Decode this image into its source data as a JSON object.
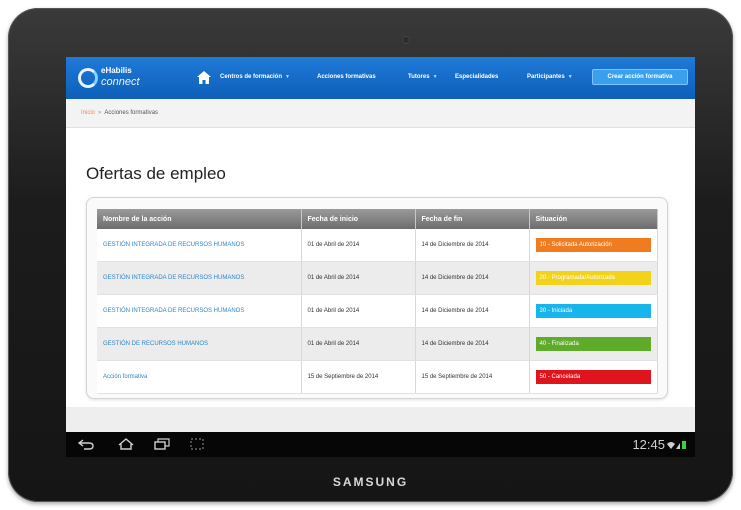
{
  "device": {
    "brand": "SAMSUNG"
  },
  "logo": {
    "line1": "eHabilis",
    "line2": "connect"
  },
  "nav": {
    "items": [
      {
        "label": "Centros de formación",
        "caret": "▼"
      },
      {
        "label": "Acciones formativas",
        "caret": ""
      },
      {
        "label": "Tutores",
        "caret": "▼"
      },
      {
        "label": "Especialidades",
        "caret": ""
      },
      {
        "label": "Participantes",
        "caret": "▼"
      }
    ],
    "create_button": "Crear acción formativa"
  },
  "breadcrumb": {
    "home": "Inicio",
    "separator": "»",
    "current": "Acciones formativas"
  },
  "page_title": "Ofertas de empleo",
  "table": {
    "headers": [
      "Nombre de la acción",
      "Fecha de inicio",
      "Fecha de fin",
      "Situación"
    ],
    "rows": [
      {
        "name": "GESTIÓN INTEGRADA DE RECURSOS HUMANOS",
        "start": "01 de Abril de 2014",
        "end": "14 de Diciembre de 2014",
        "status": "10 - Solicitada Autorización",
        "status_color": "#f07c1f"
      },
      {
        "name": "GESTIÓN INTEGRADA DE RECURSOS HUMANOS",
        "start": "01 de Abril de 2014",
        "end": "14 de Diciembre de 2014",
        "status": "20 - Programada/Autorizada",
        "status_color": "#f2d21b"
      },
      {
        "name": "GESTIÓN INTEGRADA DE RECURSOS HUMANOS",
        "start": "01 de Abril de 2014",
        "end": "14 de Diciembre de 2014",
        "status": "30 - Iniciada",
        "status_color": "#17b5ec"
      },
      {
        "name": "GESTIÓN DE RECURSOS HUMANOS",
        "start": "01 de Abril de 2014",
        "end": "14 de Diciembre de 2014",
        "status": "40 - Finalizada",
        "status_color": "#5fab2a"
      },
      {
        "name": "Acción formativa",
        "start": "15 de Septiembre de 2014",
        "end": "15 de Septiembre de 2014",
        "status": "50 - Cancelada",
        "status_color": "#e0141d"
      }
    ]
  },
  "system_bar": {
    "time": "12:45",
    "icons": [
      "back-icon",
      "home-icon",
      "recent-apps-icon",
      "screenshot-icon",
      "wifi-icon",
      "signal-icon",
      "battery-icon"
    ],
    "battery_color": "#3fcf3f"
  }
}
